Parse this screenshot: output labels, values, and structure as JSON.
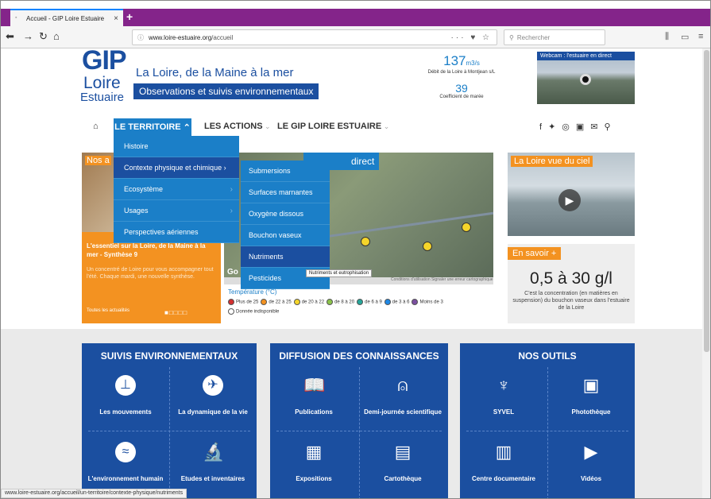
{
  "browser": {
    "tab_title": "Accueil - GIP Loire Estuaire",
    "tab_close": "×",
    "new_tab": "+",
    "url_domain": "www.loire-estuaire.org",
    "url_path": "/accueil",
    "search_placeholder": "Rechercher",
    "status_url": "www.loire-estuaire.org/accueil/un-territoire/contexte-physique/nutriments"
  },
  "header": {
    "logo_gip": "GIP",
    "logo_loire": "Loire",
    "logo_estuaire": "Estuaire",
    "tagline": "La Loire, de la Maine à la mer",
    "subtagline": "Observations et suivis environnementaux",
    "debit_value": "137",
    "debit_unit": "m3/s",
    "debit_label": "Débit de la Loire à Montjean s/L",
    "coef_value": "39",
    "coef_label": "Coefficient de marée",
    "webcam_label": "Webcam : l'estuaire en direct"
  },
  "nav": {
    "territoire": "LE TERRITOIRE",
    "actions": "LES ACTIONS",
    "gip": "LE GIP LOIRE ESTUAIRE"
  },
  "dropdown": {
    "items": [
      "Histoire",
      "Contexte physique et chimique",
      "Ecosystème",
      "Usages",
      "Perspectives aériennes"
    ]
  },
  "submenu": {
    "items": [
      "Submersions",
      "Surfaces marnantes",
      "Oxygène dissous",
      "Bouchon vaseux",
      "Nutriments",
      "Pesticides"
    ],
    "tooltip": "Nutriments et eutrophisation"
  },
  "hero": {
    "left_caption": "Nos a",
    "left_title": "L'essentiel sur la Loire, de la Maine à la mer - Synthèse 9",
    "left_text": "Un concentré de Loire pour vous accompagner tout l'été. Chaque mardi, une nouvelle synthèse.",
    "left_link": "Toutes les actualités",
    "map_header": "direct",
    "map_go": "Go",
    "map_footer": "Conditions d'utilisation   Signaler une erreur cartographique",
    "right_caption": "La Loire vue du ciel",
    "savoir_btn": "En savoir +",
    "savoir_value": "0,5 à 30 g/l",
    "savoir_desc": "C'est la concentration (en matières en suspension) du bouchon vaseux dans l'estuaire de la Loire"
  },
  "legend": {
    "title": "Température (°C)",
    "items": [
      {
        "label": "Plus de 25",
        "color": "#d32f2f"
      },
      {
        "label": "de 22 à 25",
        "color": "#f39221"
      },
      {
        "label": "de 20 à 22",
        "color": "#f5d52a"
      },
      {
        "label": "de 8 à 20",
        "color": "#8bc34a"
      },
      {
        "label": "de 6 à 9",
        "color": "#26a69a"
      },
      {
        "label": "de 3 à 6",
        "color": "#1e88e5"
      },
      {
        "label": "Moins de 3",
        "color": "#7b4fa0"
      },
      {
        "label": "Donnée indisponible",
        "color": "#ffffff"
      }
    ]
  },
  "panels": {
    "suivis": {
      "title": "SUIVIS ENVIRONNEMENTAUX",
      "tiles": [
        "Les mouvements",
        "La dynamique de la vie",
        "L'environnement humain",
        "Etudes et inventaires"
      ]
    },
    "diffusion": {
      "title": "DIFFUSION DES CONNAISSANCES",
      "tiles": [
        "Publications",
        "Demi-journée scientifique",
        "Expositions",
        "Cartothèque"
      ]
    },
    "outils": {
      "title": "NOS OUTILS",
      "tiles": [
        "SYVEL",
        "Photothèque",
        "Centre documentaire",
        "Vidéos"
      ]
    }
  },
  "colors": {
    "brand_blue": "#1b4fa0",
    "light_blue": "#1b7fc8",
    "orange": "#f39221",
    "browser_purple": "#84248a"
  }
}
